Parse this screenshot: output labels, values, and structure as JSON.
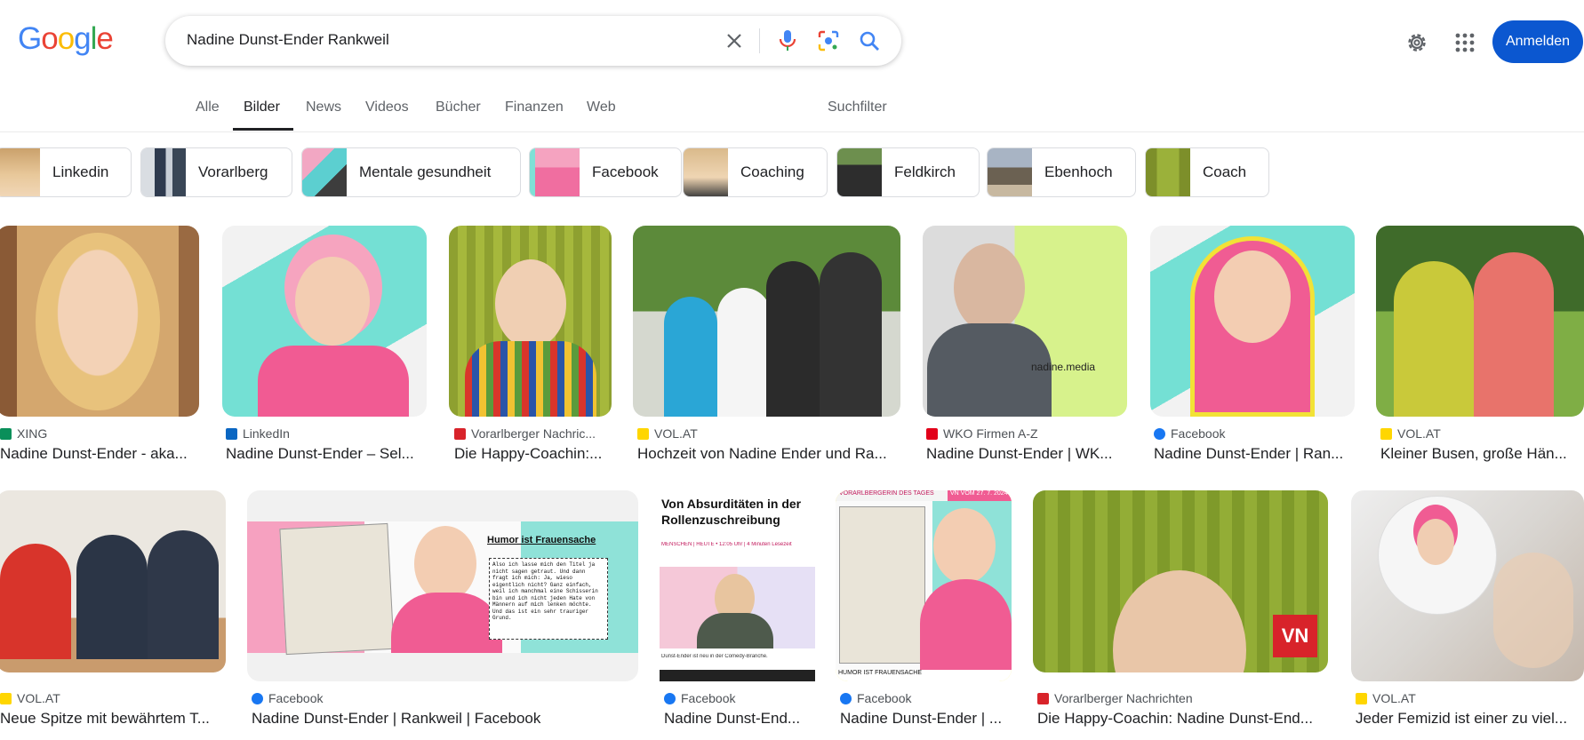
{
  "header": {
    "logo": "Google",
    "query": "Nadine Dunst-Ender Rankweil",
    "signin_label": "Anmelden"
  },
  "tabs": [
    "Alle",
    "Bilder",
    "News",
    "Videos",
    "Bücher",
    "Finanzen",
    "Web"
  ],
  "filter_label": "Suchfilter",
  "chips": [
    "Linkedin",
    "Vorarlberg",
    "Mentale gesundheit",
    "Facebook",
    "Coaching",
    "Feldkirch",
    "Ebenhoch",
    "Coach"
  ],
  "results_row1": [
    {
      "source": "XING",
      "title": "Nadine Dunst-Ender - aka..."
    },
    {
      "source": "LinkedIn",
      "title": "Nadine Dunst-Ender – Sel..."
    },
    {
      "source": "Vorarlberger Nachric...",
      "title": "Die Happy-Coachin:..."
    },
    {
      "source": "VOL.AT",
      "title": "Hochzeit von Nadine Ender und Ra..."
    },
    {
      "source": "WKO Firmen A-Z",
      "title": "Nadine Dunst-Ender | WK..."
    },
    {
      "source": "Facebook",
      "title": "Nadine Dunst-Ender | Ran..."
    },
    {
      "source": "VOL.AT",
      "title": "Kleiner Busen, große Hän..."
    }
  ],
  "results_row2": [
    {
      "source": "VOL.AT",
      "title": "Neue Spitze mit bewährtem T..."
    },
    {
      "source": "Facebook",
      "title": "Nadine Dunst-Ender | Rankweil | Facebook"
    },
    {
      "source": "Facebook",
      "title": "Nadine Dunst-End..."
    },
    {
      "source": "Facebook",
      "title": "Nadine Dunst-Ender | ..."
    },
    {
      "source": "Vorarlberger Nachrichten",
      "title": "Die Happy-Coachin: Nadine Dunst-End..."
    },
    {
      "source": "VOL.AT",
      "title": "Jeder Femizid ist einer zu viel..."
    }
  ],
  "image_texts": {
    "wko_caption": "nadine.media",
    "humor_heading": "Humor ist Frauensache",
    "humor_body": "Also ich lasse mich den Titel ja nicht sagen getraut. Und dann fragt ich mich: Ja, wieso eigentlich nicht? Ganz einfach, weil ich manchmal eine Schisserin bin und ich nicht jeden Hate von Männern auf mich lenken möchte. Und das ist ein sehr trauriger Grund.",
    "article_heading": "Von Absurditäten in der Rollenzuschreibung",
    "article_meta": "MENSCHEN | HEUTE • 12:05 Uhr | 4 Minuten Lesezeit",
    "article_caption": "Dunst-Ender ist neu in der Comedy-Branche.",
    "vn_header": "VORARLBERGERIN DES TAGES",
    "vn_date": "VN VOM 27. 7. 2024",
    "vn_footer": "HUMOR IST FRAUENSACHE",
    "vn_logo": "VN"
  },
  "colors": {
    "accent": "#0b57d0",
    "google_blue": "#4285f4",
    "google_red": "#ea4335",
    "google_yellow": "#fbbc05",
    "google_green": "#34a853"
  }
}
